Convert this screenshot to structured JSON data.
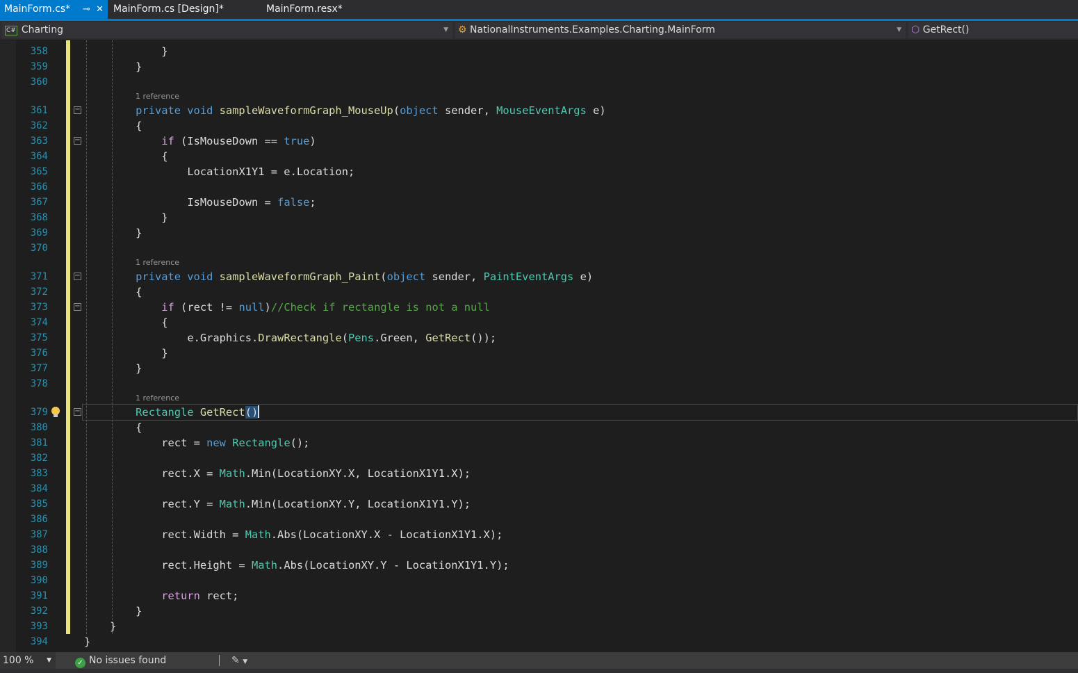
{
  "tabs": [
    {
      "label": "MainForm.cs*",
      "active": true
    },
    {
      "label": "MainForm.cs [Design]*"
    },
    {
      "label": "MainForm.resx*"
    }
  ],
  "navbar": {
    "project": "Charting",
    "project_icon": "C#",
    "class": "NationalInstruments.Examples.Charting.MainForm",
    "member": "GetRect()"
  },
  "code": {
    "lens_label": "1 reference",
    "current_line": 379,
    "lines": [
      {
        "n": 358,
        "i": 12,
        "t": [
          [
            "}",
            "pl"
          ]
        ]
      },
      {
        "n": 359,
        "i": 8,
        "t": [
          [
            "}",
            "pl"
          ]
        ]
      },
      {
        "n": 360,
        "i": 0,
        "t": []
      },
      {
        "lens": true
      },
      {
        "n": 361,
        "i": 8,
        "fold": true,
        "t": [
          [
            "private void ",
            "kw"
          ],
          [
            "sampleWaveformGraph_MouseUp",
            "fn"
          ],
          [
            "(",
            "pl"
          ],
          [
            "object ",
            "kw"
          ],
          [
            "sender, ",
            "pl"
          ],
          [
            "MouseEventArgs ",
            "type"
          ],
          [
            "e)",
            "pl"
          ]
        ]
      },
      {
        "n": 362,
        "i": 8,
        "t": [
          [
            "{",
            "pl"
          ]
        ]
      },
      {
        "n": 363,
        "i": 12,
        "fold": true,
        "t": [
          [
            "if ",
            "ctl"
          ],
          [
            "(IsMouseDown == ",
            "pl"
          ],
          [
            "true",
            "kw"
          ],
          [
            ")",
            "pl"
          ]
        ]
      },
      {
        "n": 364,
        "i": 12,
        "t": [
          [
            "{",
            "pl"
          ]
        ]
      },
      {
        "n": 365,
        "i": 16,
        "t": [
          [
            "LocationX1Y1 = e.Location;",
            "pl"
          ]
        ]
      },
      {
        "n": 366,
        "i": 0,
        "t": []
      },
      {
        "n": 367,
        "i": 16,
        "t": [
          [
            "IsMouseDown = ",
            "pl"
          ],
          [
            "false",
            "kw"
          ],
          [
            ";",
            "pl"
          ]
        ]
      },
      {
        "n": 368,
        "i": 12,
        "t": [
          [
            "}",
            "pl"
          ]
        ]
      },
      {
        "n": 369,
        "i": 8,
        "t": [
          [
            "}",
            "pl"
          ]
        ]
      },
      {
        "n": 370,
        "i": 0,
        "t": []
      },
      {
        "lens": true
      },
      {
        "n": 371,
        "i": 8,
        "fold": true,
        "t": [
          [
            "private void ",
            "kw"
          ],
          [
            "sampleWaveformGraph_Paint",
            "fn"
          ],
          [
            "(",
            "pl"
          ],
          [
            "object ",
            "kw"
          ],
          [
            "sender, ",
            "pl"
          ],
          [
            "PaintEventArgs ",
            "type"
          ],
          [
            "e)",
            "pl"
          ]
        ]
      },
      {
        "n": 372,
        "i": 8,
        "t": [
          [
            "{",
            "pl"
          ]
        ]
      },
      {
        "n": 373,
        "i": 12,
        "fold": true,
        "t": [
          [
            "if ",
            "ctl"
          ],
          [
            "(rect != ",
            "pl"
          ],
          [
            "null",
            "kw"
          ],
          [
            ")",
            "pl"
          ],
          [
            "//Check if rectangle is not a null",
            "cm"
          ]
        ]
      },
      {
        "n": 374,
        "i": 12,
        "t": [
          [
            "{",
            "pl"
          ]
        ]
      },
      {
        "n": 375,
        "i": 16,
        "t": [
          [
            "e.Graphics.",
            "pl"
          ],
          [
            "DrawRectangle",
            "fn"
          ],
          [
            "(",
            "pl"
          ],
          [
            "Pens",
            "type"
          ],
          [
            ".Green, ",
            "pl"
          ],
          [
            "GetRect",
            "fn"
          ],
          [
            "());",
            "pl"
          ]
        ]
      },
      {
        "n": 376,
        "i": 12,
        "t": [
          [
            "}",
            "pl"
          ]
        ]
      },
      {
        "n": 377,
        "i": 8,
        "t": [
          [
            "}",
            "pl"
          ]
        ]
      },
      {
        "n": 378,
        "i": 0,
        "t": []
      },
      {
        "lens": true
      },
      {
        "n": 379,
        "i": 8,
        "fold": true,
        "bulb": true,
        "t": [
          [
            "Rectangle ",
            "type"
          ],
          [
            "GetRect",
            "fn"
          ],
          [
            "()",
            "sel"
          ]
        ]
      },
      {
        "n": 380,
        "i": 8,
        "t": [
          [
            "{",
            "pl"
          ]
        ]
      },
      {
        "n": 381,
        "i": 12,
        "t": [
          [
            "rect = ",
            "pl"
          ],
          [
            "new ",
            "kw"
          ],
          [
            "Rectangle",
            "type"
          ],
          [
            "();",
            "pl"
          ]
        ]
      },
      {
        "n": 382,
        "i": 0,
        "t": []
      },
      {
        "n": 383,
        "i": 12,
        "t": [
          [
            "rect.X = ",
            "pl"
          ],
          [
            "Math",
            "type"
          ],
          [
            ".Min(LocationXY.X, LocationX1Y1.X);",
            "pl"
          ]
        ]
      },
      {
        "n": 384,
        "i": 0,
        "t": []
      },
      {
        "n": 385,
        "i": 12,
        "t": [
          [
            "rect.Y = ",
            "pl"
          ],
          [
            "Math",
            "type"
          ],
          [
            ".Min(LocationXY.Y, LocationX1Y1.Y);",
            "pl"
          ]
        ]
      },
      {
        "n": 386,
        "i": 0,
        "t": []
      },
      {
        "n": 387,
        "i": 12,
        "t": [
          [
            "rect.Width = ",
            "pl"
          ],
          [
            "Math",
            "type"
          ],
          [
            ".Abs(LocationXY.X - LocationX1Y1.X);",
            "pl"
          ]
        ]
      },
      {
        "n": 388,
        "i": 0,
        "t": []
      },
      {
        "n": 389,
        "i": 12,
        "t": [
          [
            "rect.Height = ",
            "pl"
          ],
          [
            "Math",
            "type"
          ],
          [
            ".Abs(LocationXY.Y - LocationX1Y1.Y);",
            "pl"
          ]
        ]
      },
      {
        "n": 390,
        "i": 0,
        "t": []
      },
      {
        "n": 391,
        "i": 12,
        "t": [
          [
            "return ",
            "ctl"
          ],
          [
            "rect;",
            "pl"
          ]
        ]
      },
      {
        "n": 392,
        "i": 8,
        "t": [
          [
            "}",
            "pl"
          ]
        ]
      },
      {
        "n": 393,
        "i": 4,
        "t": [
          [
            "}",
            "pl"
          ]
        ]
      },
      {
        "n": 394,
        "i": 0,
        "t": [
          [
            "}",
            "pl"
          ]
        ]
      }
    ]
  },
  "status": {
    "zoom": "100 %",
    "issues": "No issues found"
  }
}
